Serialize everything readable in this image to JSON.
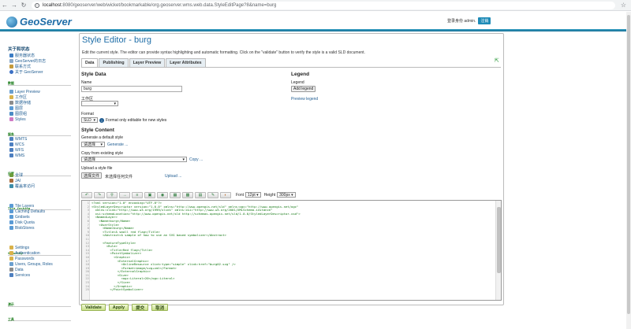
{
  "browser": {
    "url_host": "localhost",
    "url_rest": ":8080/geoserver/web/wicket/bookmarkable/org.geoserver.wms.web.data.StyleEditPage?8&name=burg"
  },
  "header": {
    "logo": "GeoServer",
    "login_text": "登录身份 admin.",
    "logout_label": "注销"
  },
  "sidebar": {
    "sections": [
      {
        "title": "关于和状态",
        "items": [
          "服务器状态",
          "GeoServer的日志",
          "联系方式",
          "关于 GeoServer"
        ]
      },
      {
        "title": "数据",
        "items": [
          "Layer Preview",
          "工作区",
          "数据存储",
          "图层",
          "图层组",
          "Styles"
        ]
      },
      {
        "title": "服务",
        "items": [
          "WMTS",
          "WCS",
          "WFS",
          "WMS"
        ]
      },
      {
        "title": "设置",
        "items": [
          "全球",
          "JAI",
          "覆盖率访问"
        ]
      },
      {
        "title": "Tile Caching",
        "items": [
          "Tile Layers",
          "Caching Defaults",
          "Gridsets",
          "Disk Quota",
          "BlobStores"
        ]
      },
      {
        "title": "Security",
        "items": [
          "Settings",
          "Authentication",
          "Passwords",
          "Users, Groups, Roles",
          "Data",
          "Services"
        ]
      },
      {
        "title": "演示",
        "items": []
      },
      {
        "title": "工具",
        "items": []
      }
    ]
  },
  "panel": {
    "title": "Style Editor - burg",
    "description": "Edit the current style. The editor can provide syntax highlighting and automatic formatting. Click on the \"validate\" button to verify the style is a valid SLD document.",
    "tabs": [
      "Data",
      "Publishing",
      "Layer Preview",
      "Layer Attributes"
    ],
    "style_data": {
      "heading": "Style Data",
      "name_label": "Name",
      "name_value": "burg",
      "workspace_label": "工作区",
      "workspace_value": "",
      "format_label": "Format",
      "format_value": "SLD",
      "format_note": "Format only editable for new styles"
    },
    "legend": {
      "heading": "Legend",
      "label": "Legend",
      "add_button": "Add legend",
      "preview_link": "Preview legend"
    },
    "style_content": {
      "heading": "Style Content",
      "default_label": "Generate a default style",
      "default_select": "请选择",
      "generate_link": "Generate ...",
      "copy_label": "Copy from existing style",
      "copy_select": "请选择",
      "copy_link": "Copy ...",
      "upload_label": "Upload a style file",
      "choose_button": "选择文件",
      "no_file": "未选择任何文件",
      "upload_link": "Upload ..."
    },
    "toolbar": {
      "font_label": "Font",
      "font_value": "12pt",
      "height_label": "Height",
      "height_value": "300px"
    },
    "code_lines": [
      "<?xml version=\"1.0\" encoding=\"UTF-8\"?>",
      "<StyledLayerDescriptor version=\"1.0.0\" xmlns=\"http://www.opengis.net/sld\" xmlns:ogc=\"http://www.opengis.net/ogc\"",
      "  xmlns:xlink=\"http://www.w3.org/1999/xlink\" xmlns:xsi=\"http://www.w3.org/2001/XMLSchema-instance\"",
      "  xsi:schemaLocation=\"http://www.opengis.net/sld http://schemas.opengis.net/sld/1.0.0/StyledLayerDescriptor.xsd\">",
      "  <NamedLayer>",
      "    <Name>burg</Name>",
      "    <UserStyle>",
      "      <Name>burg</Name>",
      "      <Title>A small red flag</Title>",
      "      <Abstract>A sample of how to use an SVG based symbolizer</Abstract>",
      "",
      "      <FeatureTypeStyle>",
      "        <Rule>",
      "          <Title>Red flag</Title>",
      "          <PointSymbolizer>",
      "            <Graphic>",
      "              <ExternalGraphic>",
      "                <OnlineResource xlink:type=\"simple\" xlink:href=\"burg02.svg\" />",
      "                <Format>image/svg+xml</Format>",
      "              </ExternalGraphic>",
      "              <Size>",
      "                <ogc:Literal>20</ogc:Literal>",
      "              </Size>",
      "            </Graphic>",
      "          </PointSymbolizer>"
    ],
    "bottom_buttons": [
      "Validate",
      "Apply",
      "提交",
      "取消"
    ]
  }
}
